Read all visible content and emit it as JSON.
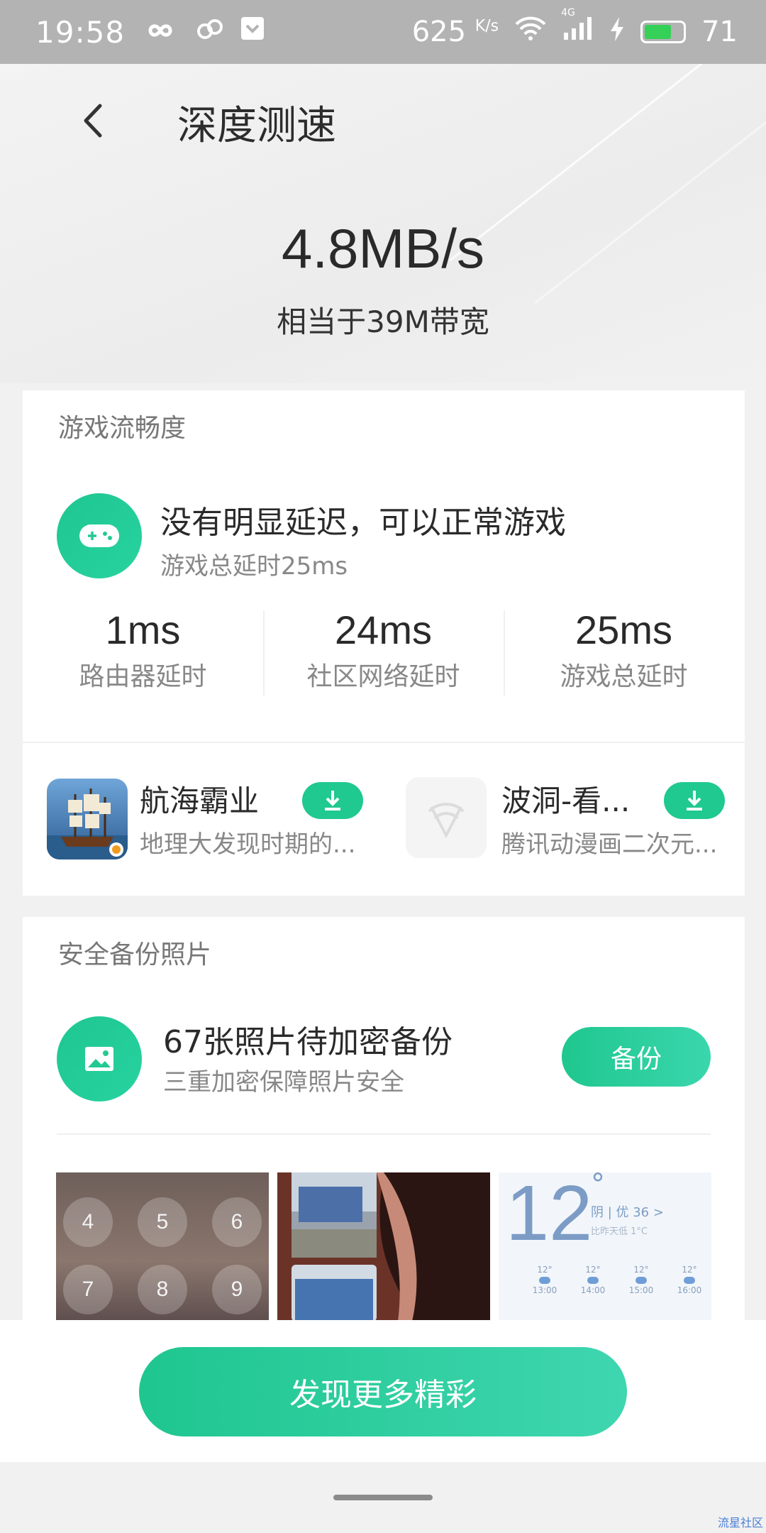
{
  "status_bar": {
    "time": "19:58",
    "net_speed": "625",
    "net_speed_unit": "K/s",
    "network_type": "4G",
    "battery": "71",
    "battery_level": 0.71,
    "icons": [
      "infinity-icon",
      "link-icon",
      "shield-app-icon",
      "wifi-icon",
      "signal-icon",
      "charging-icon",
      "battery-icon"
    ]
  },
  "header": {
    "title": "深度测速",
    "speed": "4.8MB/s",
    "bandwidth": "相当于39M带宽"
  },
  "game_card": {
    "title": "游戏流畅度",
    "status": "没有明显延迟，可以正常游戏",
    "total_latency_text": "游戏总延时25ms",
    "stats": [
      {
        "value": "1ms",
        "label": "路由器延时"
      },
      {
        "value": "24ms",
        "label": "社区网络延时"
      },
      {
        "value": "25ms",
        "label": "游戏总延时"
      }
    ],
    "apps": [
      {
        "name": "航海霸业",
        "desc": "地理大发现时期的..."
      },
      {
        "name": "波洞-看...",
        "desc": "腾讯动漫画二次元..."
      }
    ]
  },
  "backup_card": {
    "title": "安全备份照片",
    "main": "67张照片待加密备份",
    "sub": "三重加密保障照片安全",
    "button": "备份",
    "keypad_keys": [
      "4",
      "5",
      "6",
      "7",
      "8",
      "9"
    ],
    "weather": {
      "temp": "12",
      "condition": "阴 | 优 36 >",
      "detail": "比昨天低 1°C",
      "hours": [
        {
          "temp": "12°",
          "time": "13:00"
        },
        {
          "temp": "12°",
          "time": "14:00"
        },
        {
          "temp": "12°",
          "time": "15:00"
        },
        {
          "temp": "12°",
          "time": "16:00"
        }
      ]
    }
  },
  "footer": {
    "discover_button": "发现更多精彩",
    "watermark": "流星社区"
  }
}
